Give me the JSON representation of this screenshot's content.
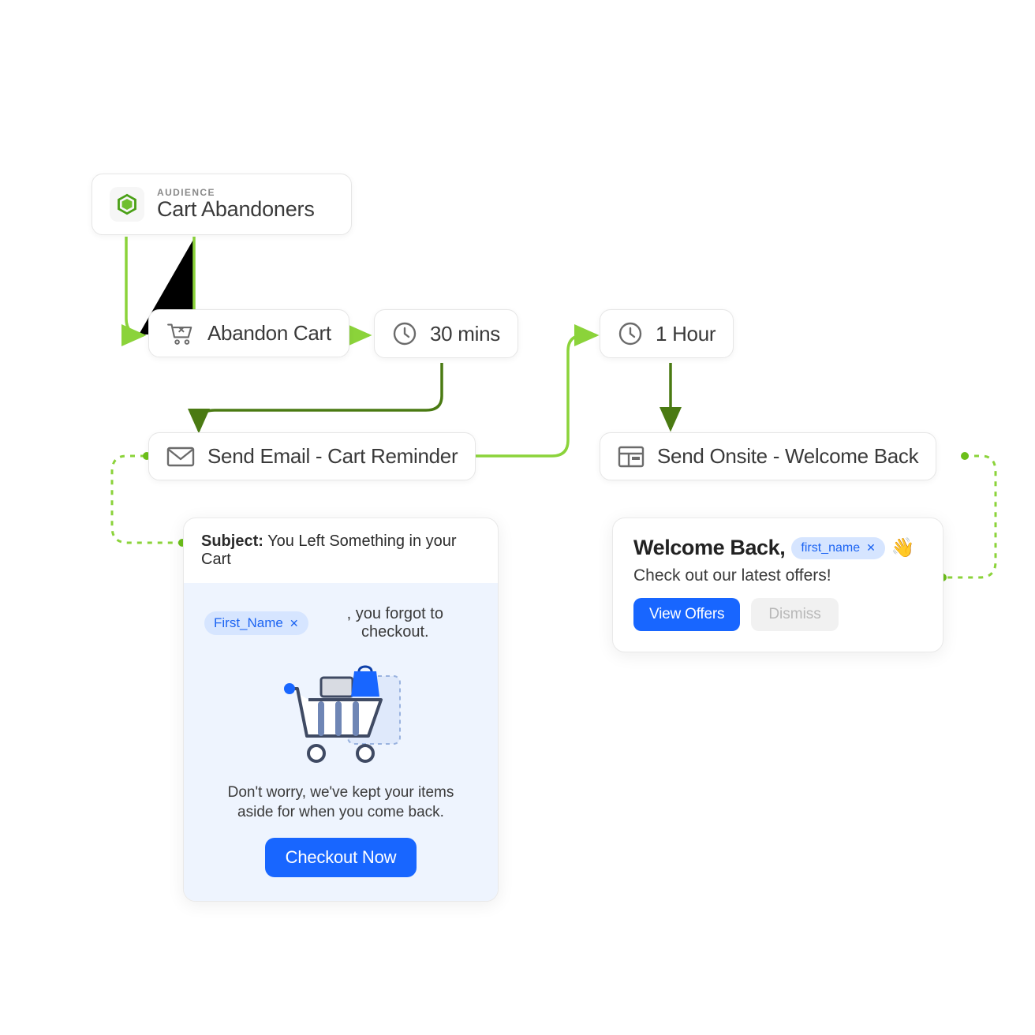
{
  "colors": {
    "green_light": "#8bd33a",
    "green_dark": "#4a7a12",
    "blue": "#1866ff",
    "pill_bg": "#d6e5ff"
  },
  "audience": {
    "kicker": "AUDIENCE",
    "title": "Cart Abandoners"
  },
  "nodes": {
    "abandon": "Abandon Cart",
    "wait30": "30 mins",
    "send_email": "Send Email - Cart Reminder",
    "wait1h": "1 Hour",
    "send_onsite": "Send Onsite - Welcome Back"
  },
  "email_preview": {
    "subject_label": "Subject:",
    "subject_value": "You Left Something in your Cart",
    "tag_text": "First_Name",
    "greeting_rest": ", you forgot to checkout.",
    "body_text": "Don't worry, we've kept your items aside for when you come back.",
    "cta": "Checkout Now"
  },
  "popup_preview": {
    "title": "Welcome Back,",
    "tag_text": "first_name",
    "emoji": "👋",
    "subtitle": "Check out our latest offers!",
    "primary": "View Offers",
    "secondary": "Dismiss"
  }
}
